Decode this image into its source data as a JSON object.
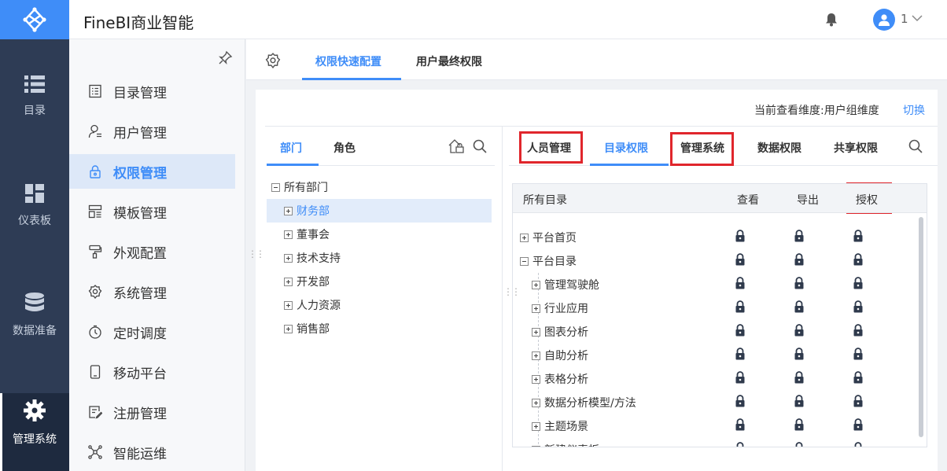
{
  "app": {
    "title": "FineBI商业智能",
    "user_name": "1"
  },
  "rail": [
    {
      "label": "目录",
      "icon": "list-icon"
    },
    {
      "label": "仪表板",
      "icon": "dashboard-icon"
    },
    {
      "label": "数据准备",
      "icon": "database-icon"
    },
    {
      "label": "管理系统",
      "icon": "gear-icon",
      "active": true
    }
  ],
  "menu": [
    {
      "label": "目录管理",
      "icon": "catalog-icon"
    },
    {
      "label": "用户管理",
      "icon": "user-icon"
    },
    {
      "label": "权限管理",
      "icon": "lock-icon",
      "active": true
    },
    {
      "label": "模板管理",
      "icon": "template-icon"
    },
    {
      "label": "外观配置",
      "icon": "brush-icon"
    },
    {
      "label": "系统管理",
      "icon": "gear-icon"
    },
    {
      "label": "定时调度",
      "icon": "timer-icon"
    },
    {
      "label": "移动平台",
      "icon": "mobile-icon"
    },
    {
      "label": "注册管理",
      "icon": "register-icon"
    },
    {
      "label": "智能运维",
      "icon": "network-icon"
    }
  ],
  "content_tabs": [
    {
      "label": "权限快速配置",
      "active": true
    },
    {
      "label": "用户最终权限"
    }
  ],
  "panel": {
    "dimension_text": "当前查看维度:用户组维度",
    "switch_label": "切换"
  },
  "left_tabs": [
    {
      "label": "部门",
      "active": true
    },
    {
      "label": "角色"
    }
  ],
  "dept_tree": [
    {
      "label": "所有部门",
      "expanded": true
    },
    {
      "label": "财务部",
      "selected": true
    },
    {
      "label": "董事会"
    },
    {
      "label": "技术支持"
    },
    {
      "label": "开发部"
    },
    {
      "label": "人力资源"
    },
    {
      "label": "销售部"
    }
  ],
  "right_tabs": [
    {
      "label": "人员管理",
      "highlighted": true
    },
    {
      "label": "目录权限",
      "active": true
    },
    {
      "label": "管理系统",
      "highlighted": true
    },
    {
      "label": "数据权限"
    },
    {
      "label": "共享权限"
    }
  ],
  "table": {
    "headers": [
      "所有目录",
      "查看",
      "导出",
      "授权"
    ],
    "rows": [
      {
        "label": "平台首页",
        "level": 0,
        "expanded": false
      },
      {
        "label": "平台目录",
        "level": 0,
        "expanded": true
      },
      {
        "label": "管理驾驶舱",
        "level": 1
      },
      {
        "label": "行业应用",
        "level": 1
      },
      {
        "label": "图表分析",
        "level": 1
      },
      {
        "label": "自助分析",
        "level": 1
      },
      {
        "label": "表格分析",
        "level": 1
      },
      {
        "label": "数据分析模型/方法",
        "level": 1
      },
      {
        "label": "主题场景",
        "level": 1
      },
      {
        "label": "新建仪表板",
        "level": 1
      }
    ]
  },
  "colors": {
    "accent": "#3f8df8",
    "rail_bg": "#2e3c55",
    "highlight_box": "#e0262c"
  }
}
